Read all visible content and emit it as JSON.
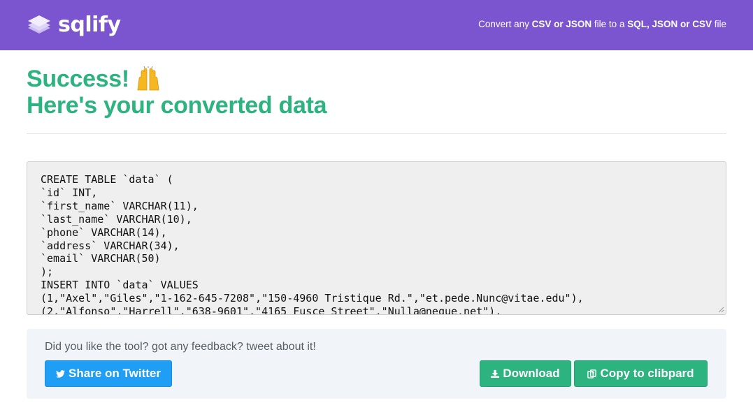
{
  "header": {
    "brand": "sqlify",
    "tagline_parts": [
      "Convert any ",
      "CSV or JSON",
      " file to a ",
      "SQL, JSON or CSV",
      " file"
    ],
    "logo_icon": "stacked-layers-icon",
    "bg_color": "#7b55cf"
  },
  "result": {
    "title": "Success!",
    "emoji_icon": "raising-hands-icon",
    "subtitle": "Here's your converted data",
    "accent_color": "#2db37f"
  },
  "output": {
    "lines": [
      "CREATE TABLE `data` (",
      "`id` INT,",
      "`first_name` VARCHAR(11),",
      "`last_name` VARCHAR(10),",
      "`phone` VARCHAR(14),",
      "`address` VARCHAR(34),",
      "`email` VARCHAR(50)",
      ");",
      "INSERT INTO `data` VALUES",
      "(1,\"Axel\",\"Giles\",\"1-162-645-7208\",\"150-4960 Tristique Rd.\",\"et.pede.Nunc@vitae.edu\"),",
      "(2,\"Alfonso\",\"Harrell\",\"638-9601\",\"4165 Fusce Street\",\"Nulla@neque.net\"),"
    ]
  },
  "feedback": {
    "prompt": "Did you like the tool? got any feedback? tweet about it!",
    "twitter_label": "Share on Twitter",
    "twitter_icon": "twitter-bird-icon",
    "download_label": "Download",
    "download_icon": "download-icon",
    "copy_label": "Copy to clibpard",
    "copy_icon": "clipboard-icon",
    "twitter_color": "#1f9ef5"
  }
}
